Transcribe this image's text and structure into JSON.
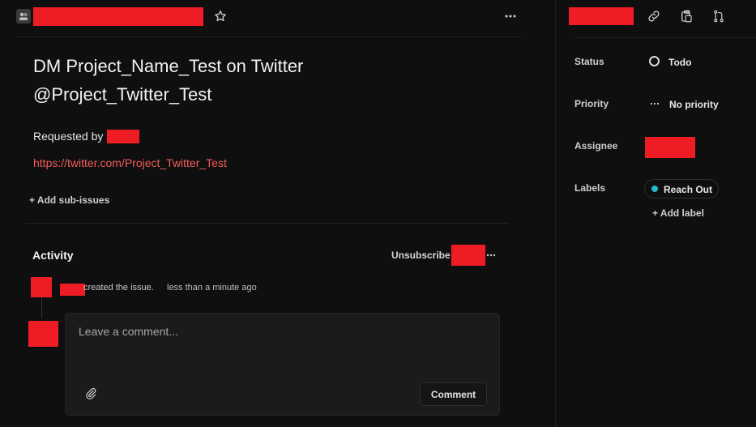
{
  "issue": {
    "title": "DM Project_Name_Test on Twitter @Project_Twitter_Test",
    "requested_by_label": "Requested by",
    "link": "https://twitter.com/Project_Twitter_Test",
    "add_sub_issues": "+ Add sub-issues"
  },
  "activity": {
    "heading": "Activity",
    "unsubscribe": "Unsubscribe",
    "event_text": "created the issue.",
    "event_time": "less than a minute ago"
  },
  "comment": {
    "placeholder": "Leave a comment...",
    "submit_label": "Comment"
  },
  "sidebar": {
    "status_label": "Status",
    "status_value": "Todo",
    "priority_label": "Priority",
    "priority_value": "No priority",
    "assignee_label": "Assignee",
    "labels_label": "Labels",
    "label_chip": "Reach Out",
    "label_color": "#26b5ce",
    "add_label": "+ Add label"
  },
  "icons": {
    "star": "star-icon",
    "more": "more-horizontal-icon",
    "link": "link-icon",
    "copy": "clipboard-copy-icon",
    "branch": "git-branch-icon",
    "attach": "paperclip-icon"
  }
}
